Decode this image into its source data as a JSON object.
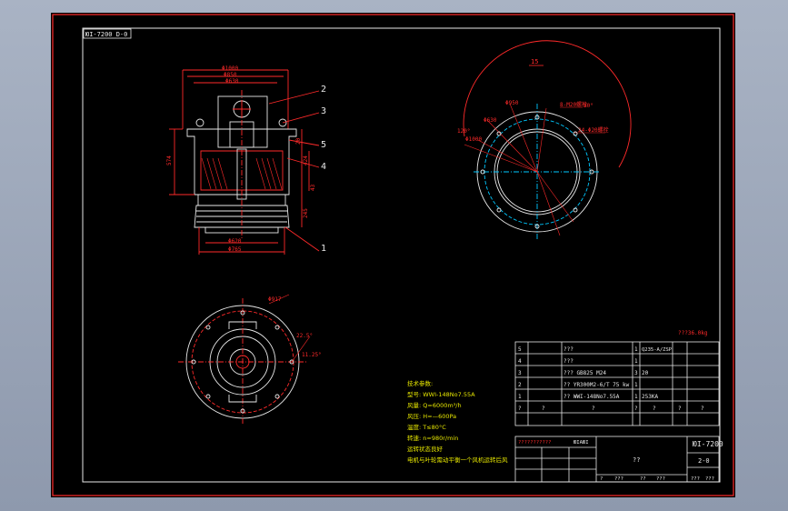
{
  "title_block_tag": "ЮІ-7200 D-0",
  "top_view_label": "15",
  "weight_note": "???36.0kg",
  "front_view": {
    "dims": [
      "Φ1000",
      "Φ850",
      "Φ630",
      "Φ620",
      "Φ765",
      "574",
      "424",
      "245",
      "20",
      "43"
    ],
    "callouts": [
      "1",
      "2",
      "3",
      "4",
      "5"
    ]
  },
  "flange_view": {
    "dims": [
      "Φ950",
      "Φ1000",
      "Φ630",
      "120°",
      "90°",
      "8-M20螺栓",
      "24-Φ20螺栓"
    ]
  },
  "bottom_view": {
    "dims": [
      "Φ917",
      "22.5°",
      "11.25°"
    ]
  },
  "tech_notes": [
    "技术参数:",
    "型号: WWI-148No7.55A",
    "风量: Q=6000m³/h",
    "风压: H=—600Pa",
    "温度: T≤80°C",
    "转速: n=980r/min",
    "运转状态良好",
    "电机与叶轮需动平衡一个风机运转后风"
  ],
  "bom": [
    {
      "no": "5",
      "code": "",
      "name": "???",
      "qty": "1",
      "material": "Q235-A/ZSP",
      "note": ""
    },
    {
      "no": "4",
      "code": "",
      "name": "???",
      "qty": "1",
      "material": "",
      "note": ""
    },
    {
      "no": "3",
      "code": "",
      "name": "??? GB825 M24",
      "qty": "3",
      "material": "20",
      "note": ""
    },
    {
      "no": "2",
      "code": "",
      "name": "?? YR300M2-6/T 75 kw",
      "qty": "1",
      "material": "",
      "note": ""
    },
    {
      "no": "1",
      "code": "",
      "name": "?? WWI-148No7.55A",
      "qty": "1",
      "material": "253KA",
      "note": ""
    }
  ],
  "bom_header": [
    "?",
    "?",
    "?",
    "?",
    "?",
    "?",
    "?"
  ],
  "title_block": {
    "company": "???????????",
    "stamp": "ЮІАЮІ",
    "drawing_title": "??",
    "drawing_no": "ЮІ-7200",
    "sheet": "2-0",
    "scale_row": [
      "?",
      "???",
      "??",
      "???",
      "???",
      "???"
    ]
  }
}
